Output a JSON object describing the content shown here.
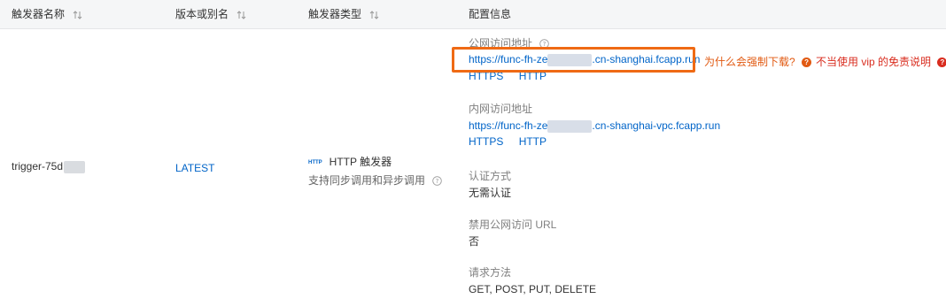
{
  "header": {
    "col_name": "触发器名称",
    "col_version": "版本或别名",
    "col_type": "触发器类型",
    "col_config": "配置信息"
  },
  "row": {
    "trigger_name": "trigger-75d",
    "version": "LATEST",
    "type_badge": "HTTP",
    "type_label": "HTTP 触发器",
    "type_desc": "支持同步调用和异步调用",
    "public_label": "公网访问地址",
    "public_url_prefix": "https://func-fh-ze",
    "public_url_suffix": ".cn-shanghai.fcapp.run",
    "public_https": "HTTPS",
    "public_http": "HTTP",
    "why_download": "为什么会强制下载?",
    "vip_disclaimer": "不当使用 vip 的免责说明",
    "private_label": "内网访问地址",
    "private_url_prefix": "https://func-fh-ze",
    "private_url_suffix": ".cn-shanghai-vpc.fcapp.run",
    "private_https": "HTTPS",
    "private_http": "HTTP",
    "auth_label": "认证方式",
    "auth_value": "无需认证",
    "disable_label": "禁用公网访问 URL",
    "disable_value": "否",
    "method_label": "请求方法",
    "method_value": "GET, POST, PUT, DELETE"
  },
  "colors": {
    "link": "#0064c8",
    "highlight": "#ef6a14",
    "warn_orange": "#e15a12",
    "warn_red": "#d92d1f"
  },
  "icons": [
    "sort-icon",
    "help-icon",
    "question-icon",
    "http-badge-icon"
  ]
}
